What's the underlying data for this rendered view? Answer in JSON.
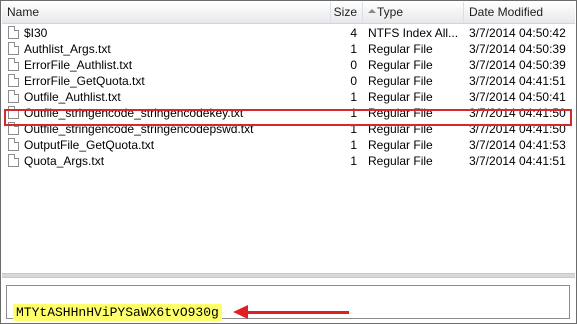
{
  "columns": {
    "name": "Name",
    "size": "Size",
    "type": "Type",
    "date": "Date Modified"
  },
  "files": [
    {
      "name": "$I30",
      "size": "4",
      "type": "NTFS Index All...",
      "date": "3/7/2014 04:50:42"
    },
    {
      "name": "Authlist_Args.txt",
      "size": "1",
      "type": "Regular File",
      "date": "3/7/2014 04:50:39"
    },
    {
      "name": "ErrorFile_Authlist.txt",
      "size": "0",
      "type": "Regular File",
      "date": "3/7/2014 04:50:39"
    },
    {
      "name": "ErrorFile_GetQuota.txt",
      "size": "0",
      "type": "Regular File",
      "date": "3/7/2014 04:41:51"
    },
    {
      "name": "Outfile_Authlist.txt",
      "size": "1",
      "type": "Regular File",
      "date": "3/7/2014 04:50:41"
    },
    {
      "name": "Outfile_stringencode_stringencodekey.txt",
      "size": "1",
      "type": "Regular File",
      "date": "3/7/2014 04:41:50"
    },
    {
      "name": "Outfile_stringencode_stringencodepswd.txt",
      "size": "1",
      "type": "Regular File",
      "date": "3/7/2014 04:41:50"
    },
    {
      "name": "OutputFile_GetQuota.txt",
      "size": "1",
      "type": "Regular File",
      "date": "3/7/2014 04:41:53"
    },
    {
      "name": "Quota_Args.txt",
      "size": "1",
      "type": "Regular File",
      "date": "3/7/2014 04:41:51"
    }
  ],
  "preview": {
    "content": "MTYtASHHnHViPYSaWX6tvO930g"
  },
  "colors": {
    "highlight_border": "#d42a2a",
    "text_highlight": "#ffff6a",
    "arrow": "#e02020"
  }
}
